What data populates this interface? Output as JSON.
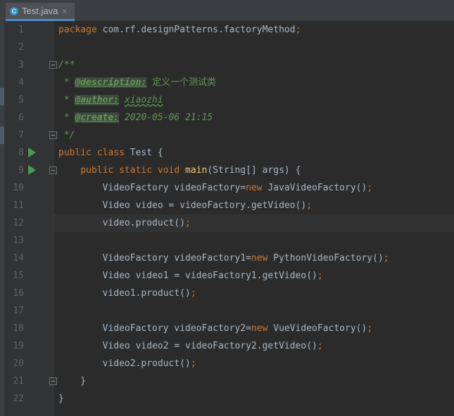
{
  "tab": {
    "title": "Test.java",
    "icon": "C",
    "close": "×"
  },
  "line_numbers": [
    "1",
    "2",
    "3",
    "4",
    "5",
    "6",
    "7",
    "8",
    "9",
    "10",
    "11",
    "12",
    "13",
    "14",
    "15",
    "16",
    "17",
    "18",
    "19",
    "20",
    "21",
    "22"
  ],
  "code": {
    "l1_kw": "package",
    "l1_rest": " com.rf.designPatterns.factoryMethod",
    "l1_semi": ";",
    "l3": "/**",
    "l4_star": " * ",
    "l4_tag": "@description:",
    "l4_text": "定义一个测试类",
    "l5_star": " * ",
    "l5_tag": "@author:",
    "l5_text": "xiaozhi",
    "l6_star": " * ",
    "l6_tag": "@create:",
    "l6_text": "2020-05-06 21:15",
    "l7": " */",
    "l8_kw": "public class",
    "l8_rest": " Test {",
    "l9_indent": "    ",
    "l9_kw": "public static void",
    "l9_fn": " main",
    "l9_rest": "(String[] args) {",
    "l10_a": "        VideoFactory videoFactory=",
    "l10_new": "new",
    "l10_b": " JavaVideoFactory()",
    "l10_semi": ";",
    "l11_a": "        Video video = videoFactory.getVideo()",
    "l11_semi": ";",
    "l12_a": "        video.product()",
    "l12_semi": ";",
    "l14_a": "        VideoFactory videoFactory1=",
    "l14_new": "new",
    "l14_b": " PythonVideoFactory()",
    "l14_semi": ";",
    "l15_a": "        Video video1 = videoFactory1.getVideo()",
    "l15_semi": ";",
    "l16_a": "        video1.product()",
    "l16_semi": ";",
    "l18_a": "        VideoFactory videoFactory2=",
    "l18_new": "new",
    "l18_b": " VueVideoFactory()",
    "l18_semi": ";",
    "l19_a": "        Video video2 = videoFactory2.getVideo()",
    "l19_semi": ";",
    "l20_a": "        video2.product()",
    "l20_semi": ";",
    "l21": "    }",
    "l22": "}"
  },
  "colors": {
    "background": "#2b2b2b",
    "gutter": "#313335",
    "keyword": "#cc7832",
    "plain": "#a9b7c6",
    "method": "#ffc66d",
    "doc_comment": "#629755",
    "line_number": "#606366",
    "run_icon": "#499c54"
  },
  "icons": [
    "java-class-icon",
    "close-icon",
    "run-gutter-icon",
    "fold-icon"
  ]
}
